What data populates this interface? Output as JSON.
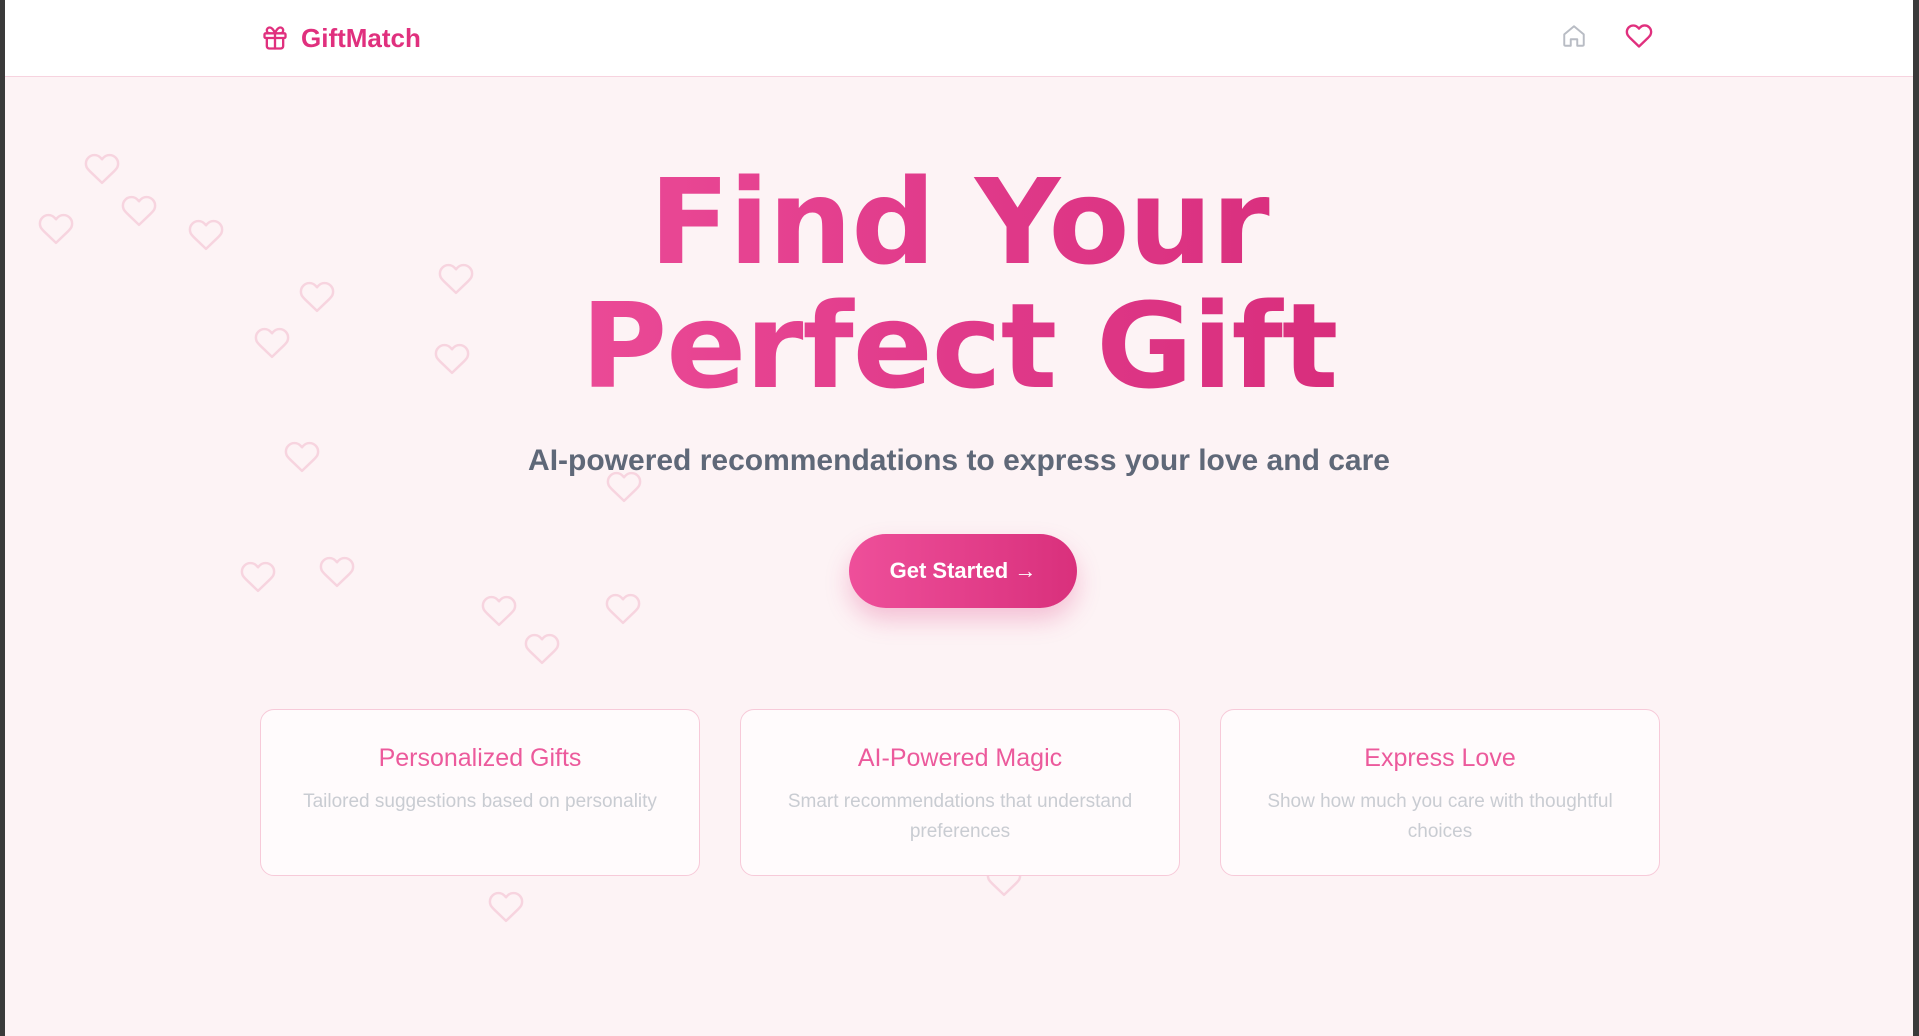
{
  "brand": {
    "name": "GiftMatch",
    "icon": "gift-icon"
  },
  "nav": {
    "home_icon": "home-icon",
    "favorites_icon": "heart-icon"
  },
  "hero": {
    "title": "Find Your Perfect Gift",
    "subtitle": "AI-powered recommendations to express your love and care",
    "cta_label": "Get Started →"
  },
  "features": [
    {
      "title": "Personalized Gifts",
      "description": "Tailored suggestions based on personality"
    },
    {
      "title": "AI-Powered Magic",
      "description": "Smart recommendations that understand preferences"
    },
    {
      "title": "Express Love",
      "description": "Show how much you care with thoughtful choices"
    }
  ],
  "colors": {
    "accent": "#e0307e",
    "background": "#fdf3f5",
    "decorative_heart": "#f7d4df",
    "subtitle": "#5f6878",
    "muted_text": "#c9ccd2"
  }
}
